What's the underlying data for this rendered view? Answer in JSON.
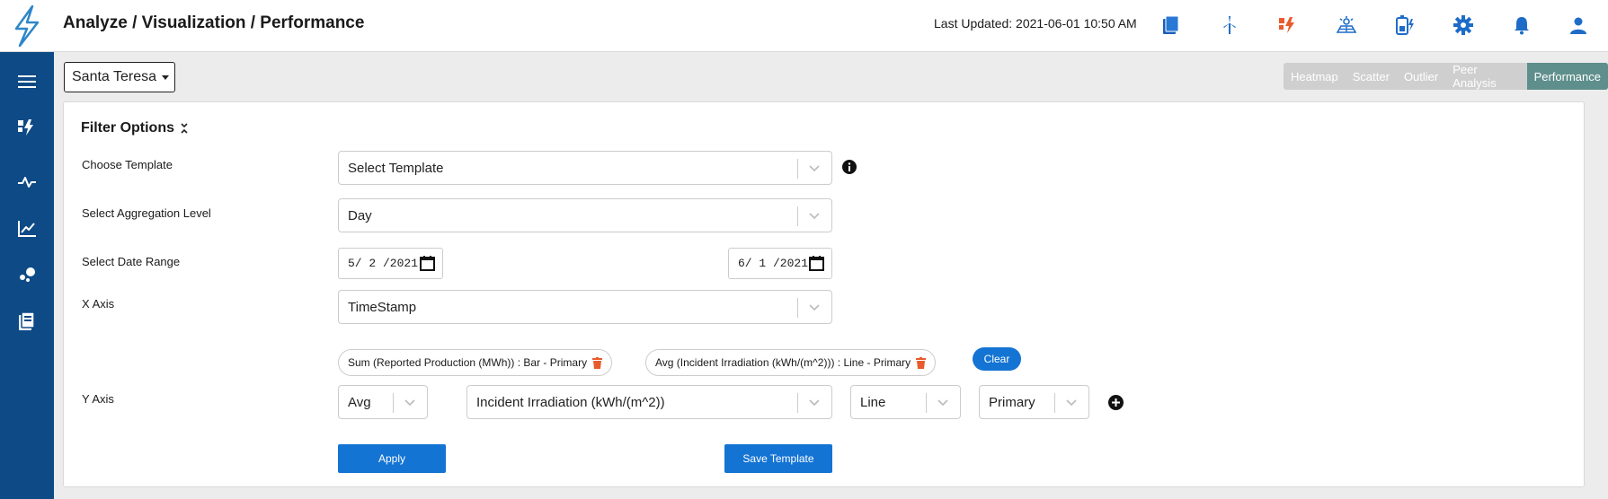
{
  "header": {
    "title": "Analyze / Visualization / Performance",
    "last_updated": "Last Updated: 2021-06-01 10:50 AM",
    "icons": [
      "reports-icon",
      "wind-turbine-icon",
      "alerts-icon",
      "solar-icon",
      "battery-icon",
      "gear-icon",
      "bell-icon",
      "user-icon"
    ]
  },
  "sidebar": {
    "items": [
      "menu-icon",
      "alerts-icon",
      "pulse-icon",
      "line-chart-icon",
      "scatter-icon",
      "reports-icon"
    ]
  },
  "site_selector": {
    "value": "Santa Teresa"
  },
  "view_tabs": {
    "items": [
      "Heatmap",
      "Scatter",
      "Outlier",
      "Peer Analysis",
      "Performance"
    ],
    "active": "Performance"
  },
  "filter": {
    "title": "Filter Options",
    "template_label": "Choose Template",
    "template_value": "Select Template",
    "aggregation_label": "Select Aggregation Level",
    "aggregation_value": "Day",
    "date_label": "Select Date Range",
    "date_start": "5/ 2 /2021",
    "date_end": "6/ 1 /2021",
    "x_axis_label": "X Axis",
    "x_axis_value": "TimeStamp",
    "y_axis_label": "Y Axis",
    "chips": [
      "Sum (Reported Production (MWh)) : Bar - Primary",
      "Avg (Incident Irradiation (kWh/(m^2))) : Line - Primary"
    ],
    "clear_label": "Clear",
    "y_function": "Avg",
    "y_metric": "Incident Irradiation (kWh/(m^2))",
    "y_chart_type": "Line",
    "y_axis_side": "Primary",
    "apply_label": "Apply",
    "save_template_label": "Save Template"
  },
  "colors": {
    "brand_blue": "#0d4a86",
    "accent_blue": "#1474d4",
    "active_tab": "#5f8f8c",
    "alert_red": "#e85b2c"
  }
}
